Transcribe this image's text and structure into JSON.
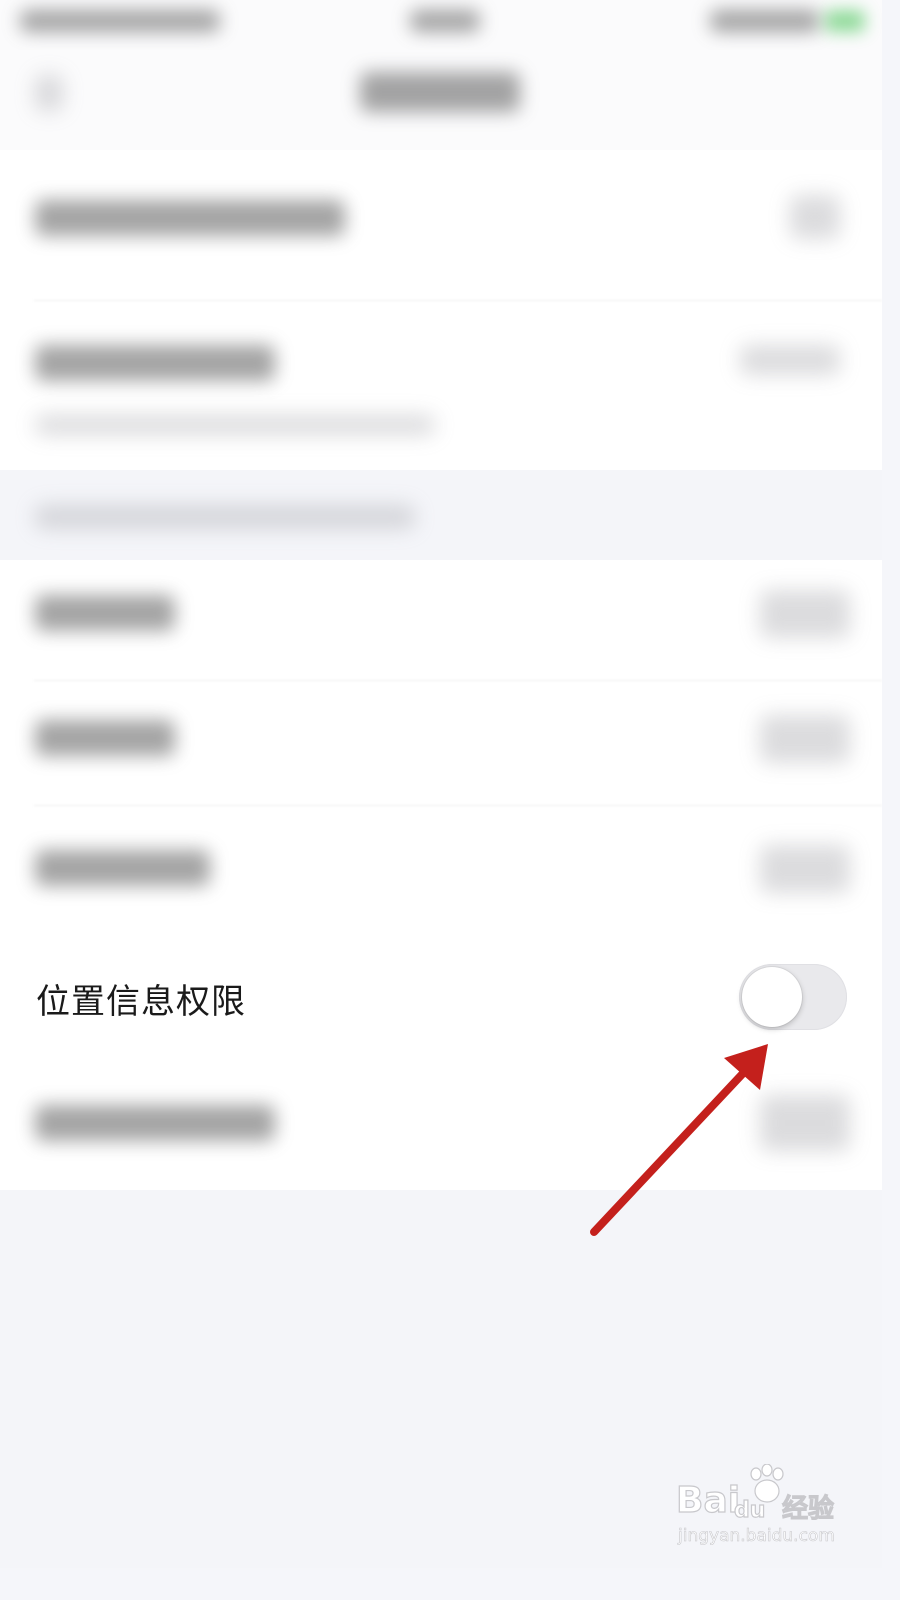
{
  "location_permission": {
    "label": "位置信息权限",
    "toggle_state": "off"
  },
  "watermark": {
    "brand": "Bai",
    "brand_suffix": "du",
    "product": "经验",
    "url": "jingyan.baidu.com"
  },
  "colors": {
    "annotation_arrow": "#c4201c",
    "toggle_track_off": "#e9e9ec",
    "background": "#f5f6fa"
  }
}
